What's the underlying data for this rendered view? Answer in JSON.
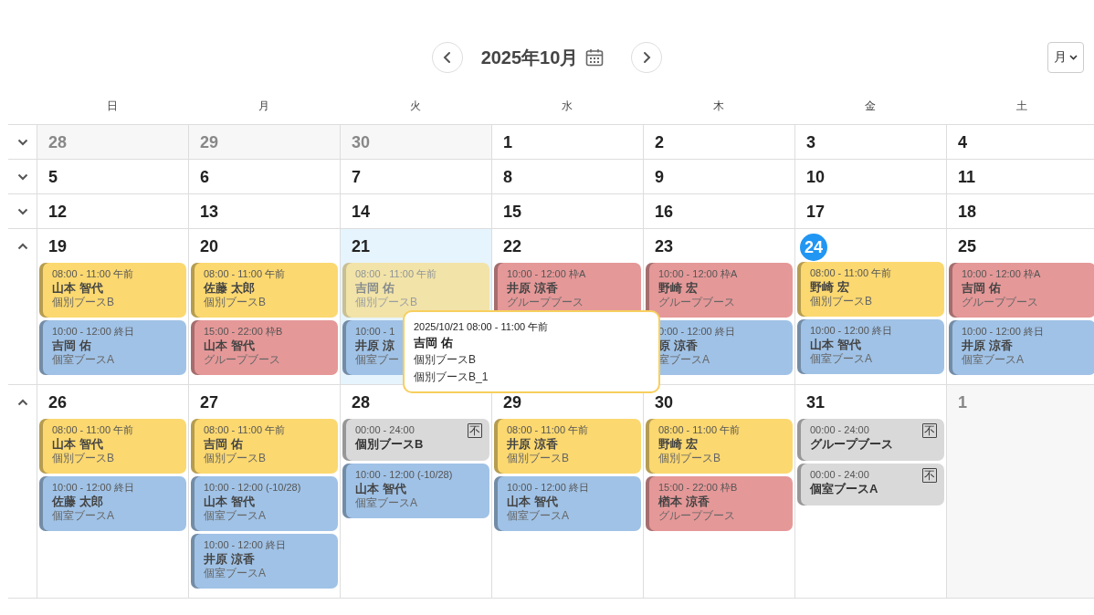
{
  "toolbar": {
    "title": "2025年10月",
    "view": "月"
  },
  "weekdays": [
    "日",
    "月",
    "火",
    "水",
    "木",
    "金",
    "土"
  ],
  "weeks": [
    {
      "expanded": false,
      "days": [
        {
          "day": "28",
          "outside": true,
          "today": false,
          "selected": false
        },
        {
          "day": "29",
          "outside": true,
          "today": false,
          "selected": false
        },
        {
          "day": "30",
          "outside": true,
          "today": false,
          "selected": false
        },
        {
          "day": "1",
          "outside": false,
          "today": false,
          "selected": false
        },
        {
          "day": "2",
          "outside": false,
          "today": false,
          "selected": false
        },
        {
          "day": "3",
          "outside": false,
          "today": false,
          "selected": false
        },
        {
          "day": "4",
          "outside": false,
          "today": false,
          "selected": false
        }
      ]
    },
    {
      "expanded": false,
      "days": [
        {
          "day": "5",
          "outside": false,
          "today": false,
          "selected": false
        },
        {
          "day": "6",
          "outside": false,
          "today": false,
          "selected": false
        },
        {
          "day": "7",
          "outside": false,
          "today": false,
          "selected": false
        },
        {
          "day": "8",
          "outside": false,
          "today": false,
          "selected": false
        },
        {
          "day": "9",
          "outside": false,
          "today": false,
          "selected": false
        },
        {
          "day": "10",
          "outside": false,
          "today": false,
          "selected": false
        },
        {
          "day": "11",
          "outside": false,
          "today": false,
          "selected": false
        }
      ]
    },
    {
      "expanded": false,
      "days": [
        {
          "day": "12",
          "outside": false,
          "today": false,
          "selected": false
        },
        {
          "day": "13",
          "outside": false,
          "today": false,
          "selected": false
        },
        {
          "day": "14",
          "outside": false,
          "today": false,
          "selected": false
        },
        {
          "day": "15",
          "outside": false,
          "today": false,
          "selected": false
        },
        {
          "day": "16",
          "outside": false,
          "today": false,
          "selected": false
        },
        {
          "day": "17",
          "outside": false,
          "today": false,
          "selected": false
        },
        {
          "day": "18",
          "outside": false,
          "today": false,
          "selected": false
        }
      ]
    },
    {
      "expanded": true,
      "days": [
        {
          "day": "19",
          "outside": false,
          "today": false,
          "selected": false,
          "events": [
            {
              "kind": "reservation",
              "color": "#fbd870",
              "dimmed": false,
              "time": "08:00 - 11:00 午前",
              "name": "山本 智代",
              "place": "個別ブースB"
            },
            {
              "kind": "reservation",
              "color": "#a0c2e6",
              "dimmed": false,
              "time": "10:00 - 12:00 終日",
              "name": "吉岡 佑",
              "place": "個室ブースA"
            }
          ]
        },
        {
          "day": "20",
          "outside": false,
          "today": false,
          "selected": false,
          "events": [
            {
              "kind": "reservation",
              "color": "#fbd870",
              "dimmed": false,
              "time": "08:00 - 11:00 午前",
              "name": "佐藤 太郎",
              "place": "個別ブースB"
            },
            {
              "kind": "reservation",
              "color": "#e59898",
              "dimmed": false,
              "time": "15:00 - 22:00 枠B",
              "name": "山本 智代",
              "place": "グループブース"
            }
          ]
        },
        {
          "day": "21",
          "outside": false,
          "today": false,
          "selected": true,
          "events": [
            {
              "kind": "reservation",
              "color": "#fbd870",
              "dimmed": true,
              "time": "08:00 - 11:00 午前",
              "name": "吉岡 佑",
              "place": "個別ブースB"
            },
            {
              "kind": "reservation",
              "color": "#a0c2e6",
              "dimmed": false,
              "time": "10:00 - 1",
              "name": "井原 涼",
              "place": "個室ブー"
            }
          ]
        },
        {
          "day": "22",
          "outside": false,
          "today": false,
          "selected": false,
          "events": [
            {
              "kind": "reservation",
              "color": "#e59898",
              "dimmed": false,
              "time": "10:00 - 12:00 枠A",
              "name": "井原 涼香",
              "place": "グループブース"
            }
          ]
        },
        {
          "day": "23",
          "outside": false,
          "today": false,
          "selected": false,
          "events": [
            {
              "kind": "reservation",
              "color": "#e59898",
              "dimmed": false,
              "time": "10:00 - 12:00 枠A",
              "name": "野崎 宏",
              "place": "グループブース"
            },
            {
              "kind": "reservation",
              "color": "#a0c2e6",
              "dimmed": false,
              "time": "0:00 - 12:00 終日",
              "name": "原 涼香",
              "place": "室ブースA"
            }
          ]
        },
        {
          "day": "24",
          "outside": false,
          "today": true,
          "selected": false,
          "events": [
            {
              "kind": "reservation",
              "color": "#fbd870",
              "dimmed": false,
              "time": "08:00 - 11:00 午前",
              "name": "野崎 宏",
              "place": "個別ブースB"
            },
            {
              "kind": "reservation",
              "color": "#a0c2e6",
              "dimmed": false,
              "time": "10:00 - 12:00 終日",
              "name": "山本 智代",
              "place": "個室ブースA"
            }
          ]
        },
        {
          "day": "25",
          "outside": false,
          "today": false,
          "selected": false,
          "events": [
            {
              "kind": "reservation",
              "color": "#e59898",
              "dimmed": false,
              "time": "10:00 - 12:00 枠A",
              "name": "吉岡 佑",
              "place": "グループブース"
            },
            {
              "kind": "reservation",
              "color": "#a0c2e6",
              "dimmed": false,
              "time": "10:00 - 12:00 終日",
              "name": "井原 涼香",
              "place": "個室ブースA"
            }
          ]
        }
      ]
    },
    {
      "expanded": true,
      "days": [
        {
          "day": "26",
          "outside": false,
          "today": false,
          "selected": false,
          "events": [
            {
              "kind": "reservation",
              "color": "#fbd870",
              "dimmed": false,
              "time": "08:00 - 11:00 午前",
              "name": "山本 智代",
              "place": "個別ブースB"
            },
            {
              "kind": "reservation",
              "color": "#a0c2e6",
              "dimmed": false,
              "time": "10:00 - 12:00 終日",
              "name": "佐藤 太郎",
              "place": "個室ブースA"
            }
          ]
        },
        {
          "day": "27",
          "outside": false,
          "today": false,
          "selected": false,
          "events": [
            {
              "kind": "reservation",
              "color": "#fbd870",
              "dimmed": false,
              "time": "08:00 - 11:00 午前",
              "name": "吉岡 佑",
              "place": "個別ブースB"
            },
            {
              "kind": "reservation",
              "color": "#a0c2e6",
              "dimmed": false,
              "time": "10:00 - 12:00 (-10/28)",
              "name": "山本 智代",
              "place": "個室ブースA"
            },
            {
              "kind": "reservation",
              "color": "#a0c2e6",
              "dimmed": false,
              "time": "10:00 - 12:00 終日",
              "name": "井原 涼香",
              "place": "個室ブースA"
            }
          ]
        },
        {
          "day": "28",
          "outside": false,
          "today": false,
          "selected": false,
          "events": [
            {
              "kind": "block",
              "color": "#d9d9d9",
              "dimmed": false,
              "time": "00:00 - 24:00",
              "name": "個別ブースB",
              "badge": "不"
            },
            {
              "kind": "reservation",
              "color": "#a0c2e6",
              "dimmed": false,
              "time": "10:00 - 12:00 (-10/28)",
              "name": "山本 智代",
              "place": "個室ブースA"
            }
          ]
        },
        {
          "day": "29",
          "outside": false,
          "today": false,
          "selected": false,
          "events": [
            {
              "kind": "reservation",
              "color": "#fbd870",
              "dimmed": false,
              "time": "08:00 - 11:00 午前",
              "name": "井原 涼香",
              "place": "個別ブースB"
            },
            {
              "kind": "reservation",
              "color": "#a0c2e6",
              "dimmed": false,
              "time": "10:00 - 12:00 終日",
              "name": "山本 智代",
              "place": "個室ブースA"
            }
          ]
        },
        {
          "day": "30",
          "outside": false,
          "today": false,
          "selected": false,
          "events": [
            {
              "kind": "reservation",
              "color": "#fbd870",
              "dimmed": false,
              "time": "08:00 - 11:00 午前",
              "name": "野崎 宏",
              "place": "個別ブースB"
            },
            {
              "kind": "reservation",
              "color": "#e59898",
              "dimmed": false,
              "time": "15:00 - 22:00 枠B",
              "name": "楢本 涼香",
              "place": "グループブース"
            }
          ]
        },
        {
          "day": "31",
          "outside": false,
          "today": false,
          "selected": false,
          "events": [
            {
              "kind": "block",
              "color": "#d9d9d9",
              "dimmed": false,
              "time": "00:00 - 24:00",
              "name": "グループブース",
              "badge": "不"
            },
            {
              "kind": "block",
              "color": "#d9d9d9",
              "dimmed": false,
              "time": "00:00 - 24:00",
              "name": "個室ブースA",
              "badge": "不"
            }
          ]
        },
        {
          "day": "1",
          "outside": true,
          "today": false,
          "selected": false
        }
      ]
    }
  ],
  "tooltip": {
    "datetime": "2025/10/21 08:00 - 11:00 午前",
    "name": "吉岡 佑",
    "place": "個別ブースB",
    "unit": "個別ブースB_1"
  }
}
